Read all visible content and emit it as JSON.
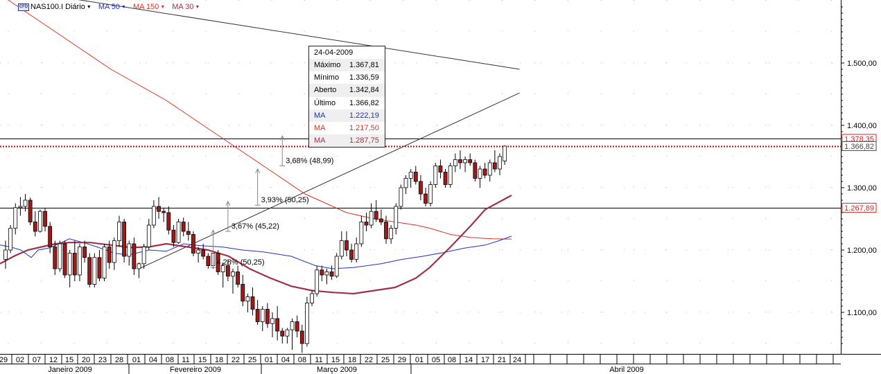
{
  "header": {
    "instrument": "NAS100.I Diário",
    "instrument_icon": "cfd-icon",
    "cfd_badge": "CFD",
    "indicators": [
      {
        "label": "MA 50",
        "color": "#2030c8"
      },
      {
        "label": "MA 150",
        "color": "#e03020"
      },
      {
        "label": "MA 30",
        "color": "#a03048"
      }
    ]
  },
  "tooltip": {
    "date": "24-04-2009",
    "rows": [
      {
        "label": "Máximo",
        "value": "1.367,81",
        "color": "#000000"
      },
      {
        "label": "Mínimo",
        "value": "1.336,59",
        "color": "#000000"
      },
      {
        "label": "Aberto",
        "value": "1.342,84",
        "color": "#000000"
      },
      {
        "label": "Último",
        "value": "1.366,82",
        "color": "#000000"
      },
      {
        "label": "MA",
        "value": "1.222,19",
        "color": "#2030c8"
      },
      {
        "label": "MA",
        "value": "1.217,50",
        "color": "#e03020"
      },
      {
        "label": "MA",
        "value": "1.287,75",
        "color": "#a03048"
      }
    ]
  },
  "price_tags": [
    {
      "label": "1.378,35",
      "value": 1378.35,
      "color": "#e02020"
    },
    {
      "label": "1.366,82",
      "value": 1366.82,
      "color": "#444444"
    },
    {
      "label": "1.267,89",
      "value": 1267.89,
      "color": "#e02020"
    }
  ],
  "chart_data": {
    "type": "candlestick",
    "title": "NAS100.I Diário",
    "ylim": [
      1030,
      1610
    ],
    "grid": true,
    "y_ticks": [
      "1.100,00",
      "1.200,00",
      "1.300,00",
      "1.400,00",
      "1.500,00"
    ],
    "y_tick_values": [
      1100,
      1200,
      1300,
      1400,
      1500
    ],
    "x_day_labels": [
      "29",
      "02",
      "07",
      "12",
      "15",
      "20",
      "23",
      "28",
      "01",
      "04",
      "08",
      "11",
      "15",
      "18",
      "22",
      "25",
      "01",
      "04",
      "08",
      "11",
      "15",
      "18",
      "22",
      "25",
      "29",
      "01",
      "05",
      "08",
      "14",
      "17",
      "21",
      "24"
    ],
    "x_month_labels": [
      "Janeiro 2009",
      "Fevereiro 2009",
      "Março 2009",
      "Abril 2009"
    ],
    "horizontal_lines": [
      {
        "value": 1378.35,
        "style": "solid",
        "color": "#000000"
      },
      {
        "value": 1366.82,
        "style": "dotted",
        "color": "#cc0000"
      },
      {
        "value": 1267.89,
        "style": "solid",
        "color": "#000000"
      }
    ],
    "trend_lines": [
      {
        "from": [
          0,
          1620
        ],
        "to": [
          104,
          1490
        ],
        "color": "#333333"
      },
      {
        "from": [
          27,
          1170
        ],
        "to": [
          104,
          1452
        ],
        "color": "#333333"
      }
    ],
    "annotations": [
      {
        "text": "4,28% (50,25)",
        "index": 42,
        "low": 1172,
        "high": 1232
      },
      {
        "text": "3,67% (45,22)",
        "index": 45,
        "low": 1230,
        "high": 1278
      },
      {
        "text": "3,93% (50,25)",
        "index": 51,
        "low": 1272,
        "high": 1330
      },
      {
        "text": "3,68% (48,99)",
        "index": 56,
        "low": 1335,
        "high": 1383
      }
    ],
    "candles": [
      {
        "o": 1185,
        "h": 1215,
        "l": 1170,
        "c": 1200
      },
      {
        "o": 1200,
        "h": 1240,
        "l": 1195,
        "c": 1235
      },
      {
        "o": 1235,
        "h": 1275,
        "l": 1225,
        "c": 1268
      },
      {
        "o": 1268,
        "h": 1285,
        "l": 1255,
        "c": 1270
      },
      {
        "o": 1270,
        "h": 1290,
        "l": 1262,
        "c": 1280
      },
      {
        "o": 1280,
        "h": 1284,
        "l": 1240,
        "c": 1245
      },
      {
        "o": 1245,
        "h": 1262,
        "l": 1222,
        "c": 1230
      },
      {
        "o": 1230,
        "h": 1265,
        "l": 1228,
        "c": 1262
      },
      {
        "o": 1262,
        "h": 1268,
        "l": 1230,
        "c": 1238
      },
      {
        "o": 1238,
        "h": 1245,
        "l": 1195,
        "c": 1205
      },
      {
        "o": 1205,
        "h": 1215,
        "l": 1160,
        "c": 1170
      },
      {
        "o": 1170,
        "h": 1215,
        "l": 1165,
        "c": 1210
      },
      {
        "o": 1210,
        "h": 1215,
        "l": 1155,
        "c": 1160
      },
      {
        "o": 1160,
        "h": 1200,
        "l": 1140,
        "c": 1195
      },
      {
        "o": 1195,
        "h": 1215,
        "l": 1150,
        "c": 1160
      },
      {
        "o": 1160,
        "h": 1210,
        "l": 1150,
        "c": 1205
      },
      {
        "o": 1205,
        "h": 1215,
        "l": 1180,
        "c": 1188
      },
      {
        "o": 1188,
        "h": 1195,
        "l": 1140,
        "c": 1145
      },
      {
        "o": 1145,
        "h": 1195,
        "l": 1140,
        "c": 1188
      },
      {
        "o": 1188,
        "h": 1200,
        "l": 1150,
        "c": 1155
      },
      {
        "o": 1155,
        "h": 1210,
        "l": 1150,
        "c": 1205
      },
      {
        "o": 1205,
        "h": 1215,
        "l": 1170,
        "c": 1180
      },
      {
        "o": 1180,
        "h": 1220,
        "l": 1168,
        "c": 1215
      },
      {
        "o": 1215,
        "h": 1255,
        "l": 1205,
        "c": 1245
      },
      {
        "o": 1245,
        "h": 1250,
        "l": 1180,
        "c": 1190
      },
      {
        "o": 1190,
        "h": 1215,
        "l": 1175,
        "c": 1210
      },
      {
        "o": 1210,
        "h": 1220,
        "l": 1160,
        "c": 1170
      },
      {
        "o": 1170,
        "h": 1180,
        "l": 1155,
        "c": 1178
      },
      {
        "o": 1178,
        "h": 1210,
        "l": 1170,
        "c": 1205
      },
      {
        "o": 1205,
        "h": 1250,
        "l": 1200,
        "c": 1240
      },
      {
        "o": 1240,
        "h": 1280,
        "l": 1235,
        "c": 1270
      },
      {
        "o": 1270,
        "h": 1285,
        "l": 1250,
        "c": 1262
      },
      {
        "o": 1262,
        "h": 1268,
        "l": 1245,
        "c": 1260
      },
      {
        "o": 1260,
        "h": 1270,
        "l": 1225,
        "c": 1232
      },
      {
        "o": 1232,
        "h": 1240,
        "l": 1205,
        "c": 1212
      },
      {
        "o": 1212,
        "h": 1250,
        "l": 1210,
        "c": 1245
      },
      {
        "o": 1245,
        "h": 1252,
        "l": 1222,
        "c": 1230
      },
      {
        "o": 1230,
        "h": 1245,
        "l": 1215,
        "c": 1225
      },
      {
        "o": 1225,
        "h": 1230,
        "l": 1190,
        "c": 1195
      },
      {
        "o": 1195,
        "h": 1205,
        "l": 1180,
        "c": 1200
      },
      {
        "o": 1200,
        "h": 1210,
        "l": 1185,
        "c": 1190
      },
      {
        "o": 1190,
        "h": 1195,
        "l": 1170,
        "c": 1175
      },
      {
        "o": 1175,
        "h": 1200,
        "l": 1170,
        "c": 1195
      },
      {
        "o": 1195,
        "h": 1200,
        "l": 1160,
        "c": 1165
      },
      {
        "o": 1165,
        "h": 1180,
        "l": 1140,
        "c": 1175
      },
      {
        "o": 1175,
        "h": 1185,
        "l": 1150,
        "c": 1158
      },
      {
        "o": 1158,
        "h": 1170,
        "l": 1130,
        "c": 1165
      },
      {
        "o": 1165,
        "h": 1175,
        "l": 1140,
        "c": 1145
      },
      {
        "o": 1145,
        "h": 1160,
        "l": 1110,
        "c": 1118
      },
      {
        "o": 1118,
        "h": 1130,
        "l": 1100,
        "c": 1125
      },
      {
        "o": 1125,
        "h": 1140,
        "l": 1095,
        "c": 1105
      },
      {
        "o": 1105,
        "h": 1120,
        "l": 1080,
        "c": 1085
      },
      {
        "o": 1085,
        "h": 1110,
        "l": 1070,
        "c": 1105
      },
      {
        "o": 1105,
        "h": 1115,
        "l": 1075,
        "c": 1082
      },
      {
        "o": 1082,
        "h": 1100,
        "l": 1060,
        "c": 1090
      },
      {
        "o": 1090,
        "h": 1110,
        "l": 1055,
        "c": 1070
      },
      {
        "o": 1070,
        "h": 1075,
        "l": 1050,
        "c": 1062
      },
      {
        "o": 1062,
        "h": 1075,
        "l": 1050,
        "c": 1072
      },
      {
        "o": 1072,
        "h": 1090,
        "l": 1040,
        "c": 1085
      },
      {
        "o": 1085,
        "h": 1095,
        "l": 1060,
        "c": 1070
      },
      {
        "o": 1070,
        "h": 1080,
        "l": 1035,
        "c": 1050
      },
      {
        "o": 1050,
        "h": 1125,
        "l": 1045,
        "c": 1115
      },
      {
        "o": 1115,
        "h": 1135,
        "l": 1110,
        "c": 1130
      },
      {
        "o": 1130,
        "h": 1175,
        "l": 1125,
        "c": 1168
      },
      {
        "o": 1168,
        "h": 1175,
        "l": 1150,
        "c": 1160
      },
      {
        "o": 1160,
        "h": 1170,
        "l": 1145,
        "c": 1165
      },
      {
        "o": 1165,
        "h": 1175,
        "l": 1152,
        "c": 1158
      },
      {
        "o": 1158,
        "h": 1195,
        "l": 1155,
        "c": 1190
      },
      {
        "o": 1190,
        "h": 1230,
        "l": 1185,
        "c": 1215
      },
      {
        "o": 1215,
        "h": 1230,
        "l": 1190,
        "c": 1200
      },
      {
        "o": 1200,
        "h": 1210,
        "l": 1180,
        "c": 1185
      },
      {
        "o": 1185,
        "h": 1220,
        "l": 1180,
        "c": 1210
      },
      {
        "o": 1210,
        "h": 1255,
        "l": 1205,
        "c": 1245
      },
      {
        "o": 1245,
        "h": 1260,
        "l": 1230,
        "c": 1240
      },
      {
        "o": 1240,
        "h": 1275,
        "l": 1235,
        "c": 1262
      },
      {
        "o": 1262,
        "h": 1280,
        "l": 1245,
        "c": 1250
      },
      {
        "o": 1250,
        "h": 1265,
        "l": 1240,
        "c": 1245
      },
      {
        "o": 1245,
        "h": 1255,
        "l": 1210,
        "c": 1218
      },
      {
        "o": 1218,
        "h": 1240,
        "l": 1210,
        "c": 1235
      },
      {
        "o": 1235,
        "h": 1275,
        "l": 1225,
        "c": 1270
      },
      {
        "o": 1270,
        "h": 1305,
        "l": 1265,
        "c": 1300
      },
      {
        "o": 1300,
        "h": 1320,
        "l": 1290,
        "c": 1315
      },
      {
        "o": 1315,
        "h": 1330,
        "l": 1300,
        "c": 1325
      },
      {
        "o": 1325,
        "h": 1335,
        "l": 1305,
        "c": 1310
      },
      {
        "o": 1310,
        "h": 1320,
        "l": 1280,
        "c": 1290
      },
      {
        "o": 1290,
        "h": 1300,
        "l": 1270,
        "c": 1275
      },
      {
        "o": 1275,
        "h": 1310,
        "l": 1270,
        "c": 1305
      },
      {
        "o": 1305,
        "h": 1340,
        "l": 1300,
        "c": 1335
      },
      {
        "o": 1335,
        "h": 1345,
        "l": 1315,
        "c": 1325
      },
      {
        "o": 1325,
        "h": 1330,
        "l": 1300,
        "c": 1305
      },
      {
        "o": 1305,
        "h": 1340,
        "l": 1300,
        "c": 1335
      },
      {
        "o": 1335,
        "h": 1355,
        "l": 1325,
        "c": 1345
      },
      {
        "o": 1345,
        "h": 1360,
        "l": 1330,
        "c": 1340
      },
      {
        "o": 1340,
        "h": 1350,
        "l": 1325,
        "c": 1345
      },
      {
        "o": 1345,
        "h": 1355,
        "l": 1335,
        "c": 1340
      },
      {
        "o": 1340,
        "h": 1345,
        "l": 1310,
        "c": 1315
      },
      {
        "o": 1315,
        "h": 1335,
        "l": 1300,
        "c": 1330
      },
      {
        "o": 1330,
        "h": 1340,
        "l": 1315,
        "c": 1320
      },
      {
        "o": 1320,
        "h": 1345,
        "l": 1310,
        "c": 1340
      },
      {
        "o": 1340,
        "h": 1360,
        "l": 1325,
        "c": 1330
      },
      {
        "o": 1330,
        "h": 1355,
        "l": 1320,
        "c": 1350
      },
      {
        "o": 1342.84,
        "h": 1367.81,
        "l": 1336.59,
        "c": 1366.82
      }
    ],
    "ma50": [
      [
        0,
        1208
      ],
      [
        15,
        1205
      ],
      [
        30,
        1200
      ],
      [
        45,
        1188
      ],
      [
        55,
        1200
      ],
      [
        70,
        1203
      ],
      [
        85,
        1210
      ],
      [
        100,
        1218
      ],
      [
        120,
        1212
      ],
      [
        140,
        1205
      ],
      [
        165,
        1195
      ],
      [
        185,
        1192
      ],
      [
        215,
        1200
      ],
      [
        240,
        1198
      ],
      [
        265,
        1210
      ],
      [
        290,
        1207
      ],
      [
        320,
        1205
      ],
      [
        350,
        1200
      ],
      [
        380,
        1197
      ],
      [
        420,
        1190
      ],
      [
        455,
        1175
      ],
      [
        480,
        1170
      ],
      [
        510,
        1172
      ],
      [
        550,
        1178
      ],
      [
        580,
        1185
      ],
      [
        610,
        1190
      ],
      [
        640,
        1196
      ],
      [
        670,
        1203
      ],
      [
        700,
        1208
      ],
      [
        720,
        1215
      ],
      [
        738,
        1222.19
      ]
    ],
    "ma150": [
      [
        0,
        1610
      ],
      [
        40,
        1580
      ],
      [
        80,
        1550
      ],
      [
        120,
        1520
      ],
      [
        160,
        1490
      ],
      [
        200,
        1465
      ],
      [
        240,
        1440
      ],
      [
        280,
        1410
      ],
      [
        320,
        1380
      ],
      [
        360,
        1350
      ],
      [
        400,
        1320
      ],
      [
        440,
        1290
      ],
      [
        470,
        1275
      ],
      [
        500,
        1260
      ],
      [
        540,
        1250
      ],
      [
        570,
        1245
      ],
      [
        600,
        1240
      ],
      [
        620,
        1235
      ],
      [
        650,
        1225
      ],
      [
        680,
        1220
      ],
      [
        710,
        1218
      ],
      [
        738,
        1217.5
      ]
    ],
    "ma30": [
      [
        0,
        1178
      ],
      [
        20,
        1190
      ],
      [
        40,
        1200
      ],
      [
        60,
        1205
      ],
      [
        80,
        1210
      ],
      [
        100,
        1212
      ],
      [
        130,
        1212
      ],
      [
        160,
        1208
      ],
      [
        190,
        1204
      ],
      [
        215,
        1205
      ],
      [
        240,
        1210
      ],
      [
        270,
        1205
      ],
      [
        300,
        1200
      ],
      [
        330,
        1190
      ],
      [
        360,
        1170
      ],
      [
        390,
        1155
      ],
      [
        420,
        1142
      ],
      [
        450,
        1135
      ],
      [
        480,
        1132
      ],
      [
        510,
        1130
      ],
      [
        540,
        1135
      ],
      [
        570,
        1140
      ],
      [
        600,
        1155
      ],
      [
        620,
        1172
      ],
      [
        650,
        1205
      ],
      [
        680,
        1240
      ],
      [
        700,
        1265
      ],
      [
        738,
        1287.75
      ]
    ]
  }
}
